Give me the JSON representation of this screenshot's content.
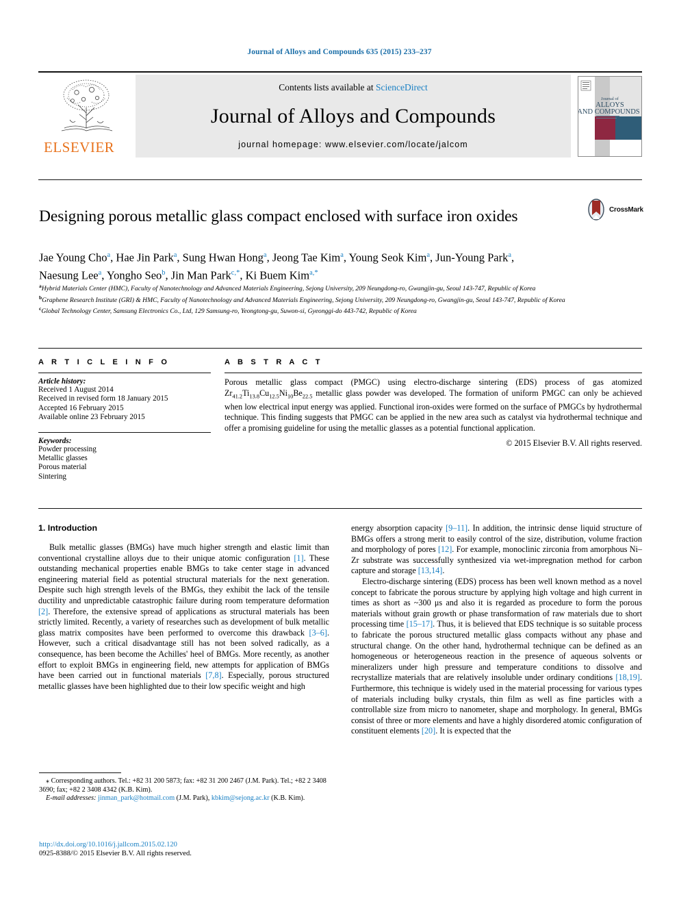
{
  "running_head": "Journal of Alloys and Compounds 635 (2015) 233–237",
  "masthead": {
    "contents_prefix": "Contents lists available at ",
    "sciencedirect": "ScienceDirect",
    "journal_title": "Journal of Alloys and Compounds",
    "homepage": "journal homepage: www.elsevier.com/locate/jalcom",
    "publisher": "ELSEVIER",
    "cover": {
      "line1": "Journal of",
      "line2": "ALLOYS",
      "line3": "AND COMPOUNDS"
    }
  },
  "article": {
    "title": "Designing porous metallic glass compact enclosed with surface iron oxides",
    "crossmark_label": "CrossMark",
    "authors_line1": "Jae Young Cho a, Hae Jin Park a, Sung Hwan Hong a, Jeong Tae Kim a, Young Seok Kim a, Jun-Young Park a,",
    "authors_line2": "Naesung Lee a, Yongho Seo b, Jin Man Park c,*, Ki Buem Kim a,*",
    "authors": [
      {
        "name": "Jae Young Cho",
        "sup": "a"
      },
      {
        "name": "Hae Jin Park",
        "sup": "a"
      },
      {
        "name": "Sung Hwan Hong",
        "sup": "a"
      },
      {
        "name": "Jeong Tae Kim",
        "sup": "a"
      },
      {
        "name": "Young Seok Kim",
        "sup": "a"
      },
      {
        "name": "Jun-Young Park",
        "sup": "a"
      },
      {
        "name": "Naesung Lee",
        "sup": "a"
      },
      {
        "name": "Yongho Seo",
        "sup": "b"
      },
      {
        "name": "Jin Man Park",
        "sup": "c,*"
      },
      {
        "name": "Ki Buem Kim",
        "sup": "a,*"
      }
    ],
    "affiliations": [
      {
        "mark": "a",
        "text": "Hybrid Materials Center (HMC), Faculty of Nanotechnology and Advanced Materials Engineering, Sejong University, 209 Neungdong-ro, Gwangjin-gu, Seoul 143-747, Republic of Korea"
      },
      {
        "mark": "b",
        "text": "Graphene Research Institute (GRI) & HMC, Faculty of Nanotechnology and Advanced Materials Engineering, Sejong University, 209 Neungdong-ro, Gwangjin-gu, Seoul 143-747, Republic of Korea"
      },
      {
        "mark": "c",
        "text": "Global Technology Center, Samsung Electronics Co., Ltd, 129 Samsung-ro, Yeongtong-gu, Suwon-si, Gyeonggi-do 443-742, Republic of Korea"
      }
    ]
  },
  "article_info": {
    "heading": "A R T I C L E    I N F O",
    "history_label": "Article history:",
    "history": [
      "Received 1 August 2014",
      "Received in revised form 18 January 2015",
      "Accepted 16 February 2015",
      "Available online 23 February 2015"
    ],
    "keywords_label": "Keywords:",
    "keywords": [
      "Powder processing",
      "Metallic glasses",
      "Porous material",
      "Sintering"
    ]
  },
  "abstract": {
    "heading": "A B S T R A C T",
    "text_part1": "Porous metallic glass compact (PMGC) using electro-discharge sintering (EDS) process of gas atomized Zr",
    "sub1": "41.2",
    "el2": "Ti",
    "sub2": "13.8",
    "el3": "Cu",
    "sub3": "12.5",
    "el4": "Ni",
    "sub4": "10",
    "el5": "Be",
    "sub5": "22.5",
    "text_part2": " metallic glass powder was developed. The formation of uniform PMGC can only be achieved when low electrical input energy was applied. Functional iron-oxides were formed on the surface of PMGCs by hydrothermal technique. This finding suggests that PMGC can be applied in the new area such as catalyst via hydrothermal technique and offer a promising guideline for using the metallic glasses as a potential functional application.",
    "copyright": "© 2015 Elsevier B.V. All rights reserved."
  },
  "body": {
    "section_title": "1. Introduction",
    "left_para1_a": "Bulk metallic glasses (BMGs) have much higher strength and elastic limit than conventional crystalline alloys due to their unique atomic configuration ",
    "left_ref1": "[1]",
    "left_para1_b": ". These outstanding mechanical properties enable BMGs to take center stage in advanced engineering material field as potential structural materials for the next generation. Despite such high strength levels of the BMGs, they exhibit the lack of the tensile ductility and unpredictable catastrophic failure during room temperature deformation ",
    "left_ref2": "[2]",
    "left_para1_c": ". Therefore, the extensive spread of applications as structural materials has been strictly limited. Recently, a variety of researches such as development of bulk metallic glass matrix composites have been performed to overcome this drawback ",
    "left_ref3": "[3–6]",
    "left_para1_d": ". However, such a critical disadvantage still has not been solved radically, as a consequence, has been become the Achilles' heel of BMGs. More recently, as another effort to exploit BMGs in engineering field, new attempts for application of BMGs have been carried out in functional materials ",
    "left_ref4": "[7,8]",
    "left_para1_e": ". Especially, porous structured metallic glasses have been highlighted due to their low specific weight and high",
    "right_para1_a": "energy absorption capacity ",
    "right_ref1": "[9–11]",
    "right_para1_b": ". In addition, the intrinsic dense liquid structure of BMGs offers a strong merit to easily control of the size, distribution, volume fraction and morphology of pores ",
    "right_ref2": "[12]",
    "right_para1_c": ". For example, monoclinic zirconia from amorphous Ni–Zr substrate was successfully synthesized via wet-impregnation method for carbon capture and storage ",
    "right_ref3": "[13,14]",
    "right_para1_d": ".",
    "right_para2_a": "Electro-discharge sintering (EDS) process has been well known method as a novel concept to fabricate the porous structure by applying high voltage and high current in times as short as ~300 μs and also it is regarded as procedure to form the porous materials without grain growth or phase transformation of raw materials due to short processing time ",
    "right_ref4": "[15–17]",
    "right_para2_b": ". Thus, it is believed that EDS technique is so suitable process to fabricate the porous structured metallic glass compacts without any phase and structural change. On the other hand, hydrothermal technique can be defined as an homogeneous or heterogeneous reaction in the presence of aqueous solvents or mineralizers under high pressure and temperature conditions to dissolve and recrystallize materials that are relatively insoluble under ordinary conditions ",
    "right_ref5": "[18,19]",
    "right_para2_c": ". Furthermore, this technique is widely used in the material processing for various types of materials including bulky crystals, thin film as well as fine particles with a controllable size from micro to nanometer, shape and morphology. In general, BMGs consist of three or more elements and have a highly disordered atomic configuration of constituent elements ",
    "right_ref6": "[20]",
    "right_para2_d": ". It is expected that the"
  },
  "footnotes": {
    "corresponding_marker": "⁎",
    "corresponding_text": "Corresponding authors. Tel.: +82 31 200 5873; fax: +82 31 200 2467 (J.M. Park). Tel.; +82 2 3408 3690; fax; +82 2 3408 4342 (K.B. Kim).",
    "email_label": "E-mail addresses:",
    "email1": "jinman_park@hotmail.com",
    "email1_owner": " (J.M. Park), ",
    "email2": "kbkim@sejong.ac.kr",
    "email2_owner": " (K.B. Kim)."
  },
  "doi": {
    "url": "http://dx.doi.org/10.1016/j.jallcom.2015.02.120",
    "issn_line": "0925-8388/© 2015 Elsevier B.V. All rights reserved."
  },
  "colors": {
    "link": "#1a80c4",
    "running_head": "#1a6ea8",
    "elsevier_orange": "#E8721C",
    "crossmark_red": "#9e2b25"
  }
}
